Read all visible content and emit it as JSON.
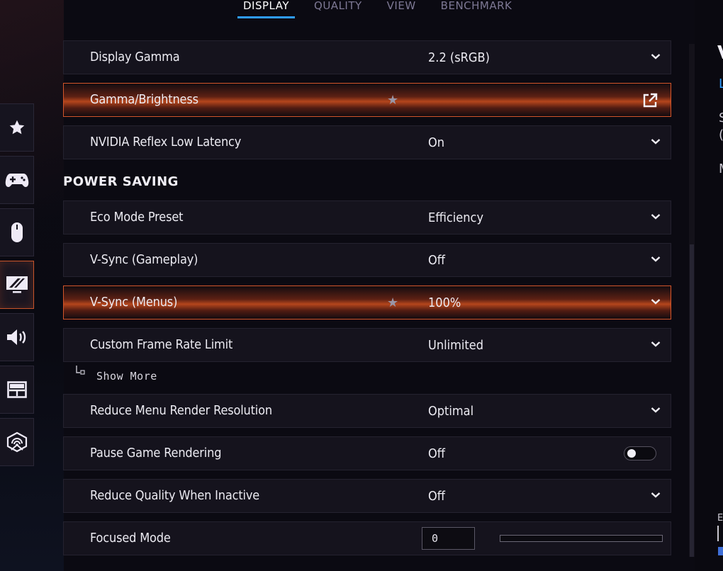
{
  "tabs": [
    {
      "label": "DISPLAY",
      "active": true
    },
    {
      "label": "QUALITY",
      "active": false
    },
    {
      "label": "VIEW",
      "active": false
    },
    {
      "label": "BENCHMARK",
      "active": false
    }
  ],
  "sidenav": [
    {
      "icon": "star-icon",
      "active": false
    },
    {
      "icon": "gamepad-icon",
      "active": false
    },
    {
      "icon": "mouse-icon",
      "active": false
    },
    {
      "icon": "monitor-icon",
      "active": true
    },
    {
      "icon": "speaker-icon",
      "active": false
    },
    {
      "icon": "layout-icon",
      "active": false
    },
    {
      "icon": "network-icon",
      "active": false
    }
  ],
  "rows": {
    "display_gamma": {
      "label": "Display Gamma",
      "value": "2.2 (sRGB)"
    },
    "gamma_brightness": {
      "label": "Gamma/Brightness",
      "favorite": true
    },
    "reflex": {
      "label": "NVIDIA Reflex Low Latency",
      "value": "On"
    },
    "eco_mode": {
      "label": "Eco Mode Preset",
      "value": "Efficiency"
    },
    "vsync_gameplay": {
      "label": "V-Sync (Gameplay)",
      "value": "Off"
    },
    "vsync_menus": {
      "label": "V-Sync (Menus)",
      "value": "100%",
      "favorite": true
    },
    "frame_limit": {
      "label": "Custom Frame Rate Limit",
      "value": "Unlimited"
    },
    "menu_res": {
      "label": "Reduce Menu Render Resolution",
      "value": "Optimal"
    },
    "pause_render": {
      "label": "Pause Game Rendering",
      "value": "Off",
      "toggle_on": false
    },
    "reduce_quality": {
      "label": "Reduce Quality When Inactive",
      "value": "Off"
    },
    "focused_mode": {
      "label": "Focused Mode",
      "value": "0",
      "slider_fraction": 0.0
    }
  },
  "section": {
    "power_saving": "POWER SAVING"
  },
  "show_more": "Show More",
  "right_panel": {
    "title": "V",
    "link": "L",
    "line1": "S",
    "line2": "(",
    "line3": "M",
    "footer": "E"
  },
  "colors": {
    "accent_blue": "#2f9cff",
    "highlight_orange": "#d4552a"
  }
}
